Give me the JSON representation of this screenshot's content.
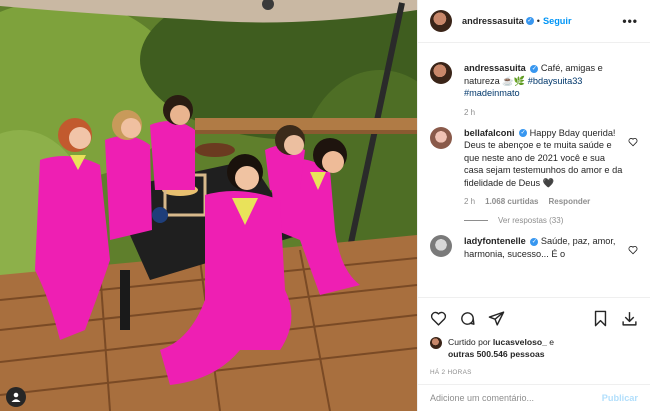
{
  "post": {
    "username": "andressasuita",
    "follow_label": "Seguir",
    "more_label": "•••",
    "caption": {
      "username": "andressasuita",
      "text": "Café, amigas e natureza ☕🌿",
      "hashtag1": "#bdaysuita33",
      "hashtag2": "#madeinmato",
      "time": "2 h"
    },
    "comments": [
      {
        "username": "bellafalconi",
        "text": "Happy Bday querida! Deus te abençoe e te muita saúde e que neste ano de 2021 você e sua casa sejam testemunhos do amor e da fidelidade de Deus 🖤",
        "time": "2 h",
        "likes": "1.068 curtidas",
        "reply_label": "Responder",
        "view_replies": "Ver respostas (33)"
      },
      {
        "username": "ladyfontenelle",
        "text": "Saúde, paz, amor, harmonia, sucesso... É o"
      }
    ],
    "liked_by": {
      "prefix": "Curtido por",
      "user": "lucasveloso_",
      "and": "e",
      "others": "outras 500.546 pessoas"
    },
    "time_ago": "HÁ 2 HORAS",
    "comment_placeholder": "Adicione um comentário...",
    "publish_label": "Publicar"
  },
  "icons": [
    "heart-icon",
    "comment-icon",
    "share-icon",
    "bookmark-icon",
    "download-icon",
    "user-tag-icon",
    "verified-icon",
    "more-icon"
  ]
}
